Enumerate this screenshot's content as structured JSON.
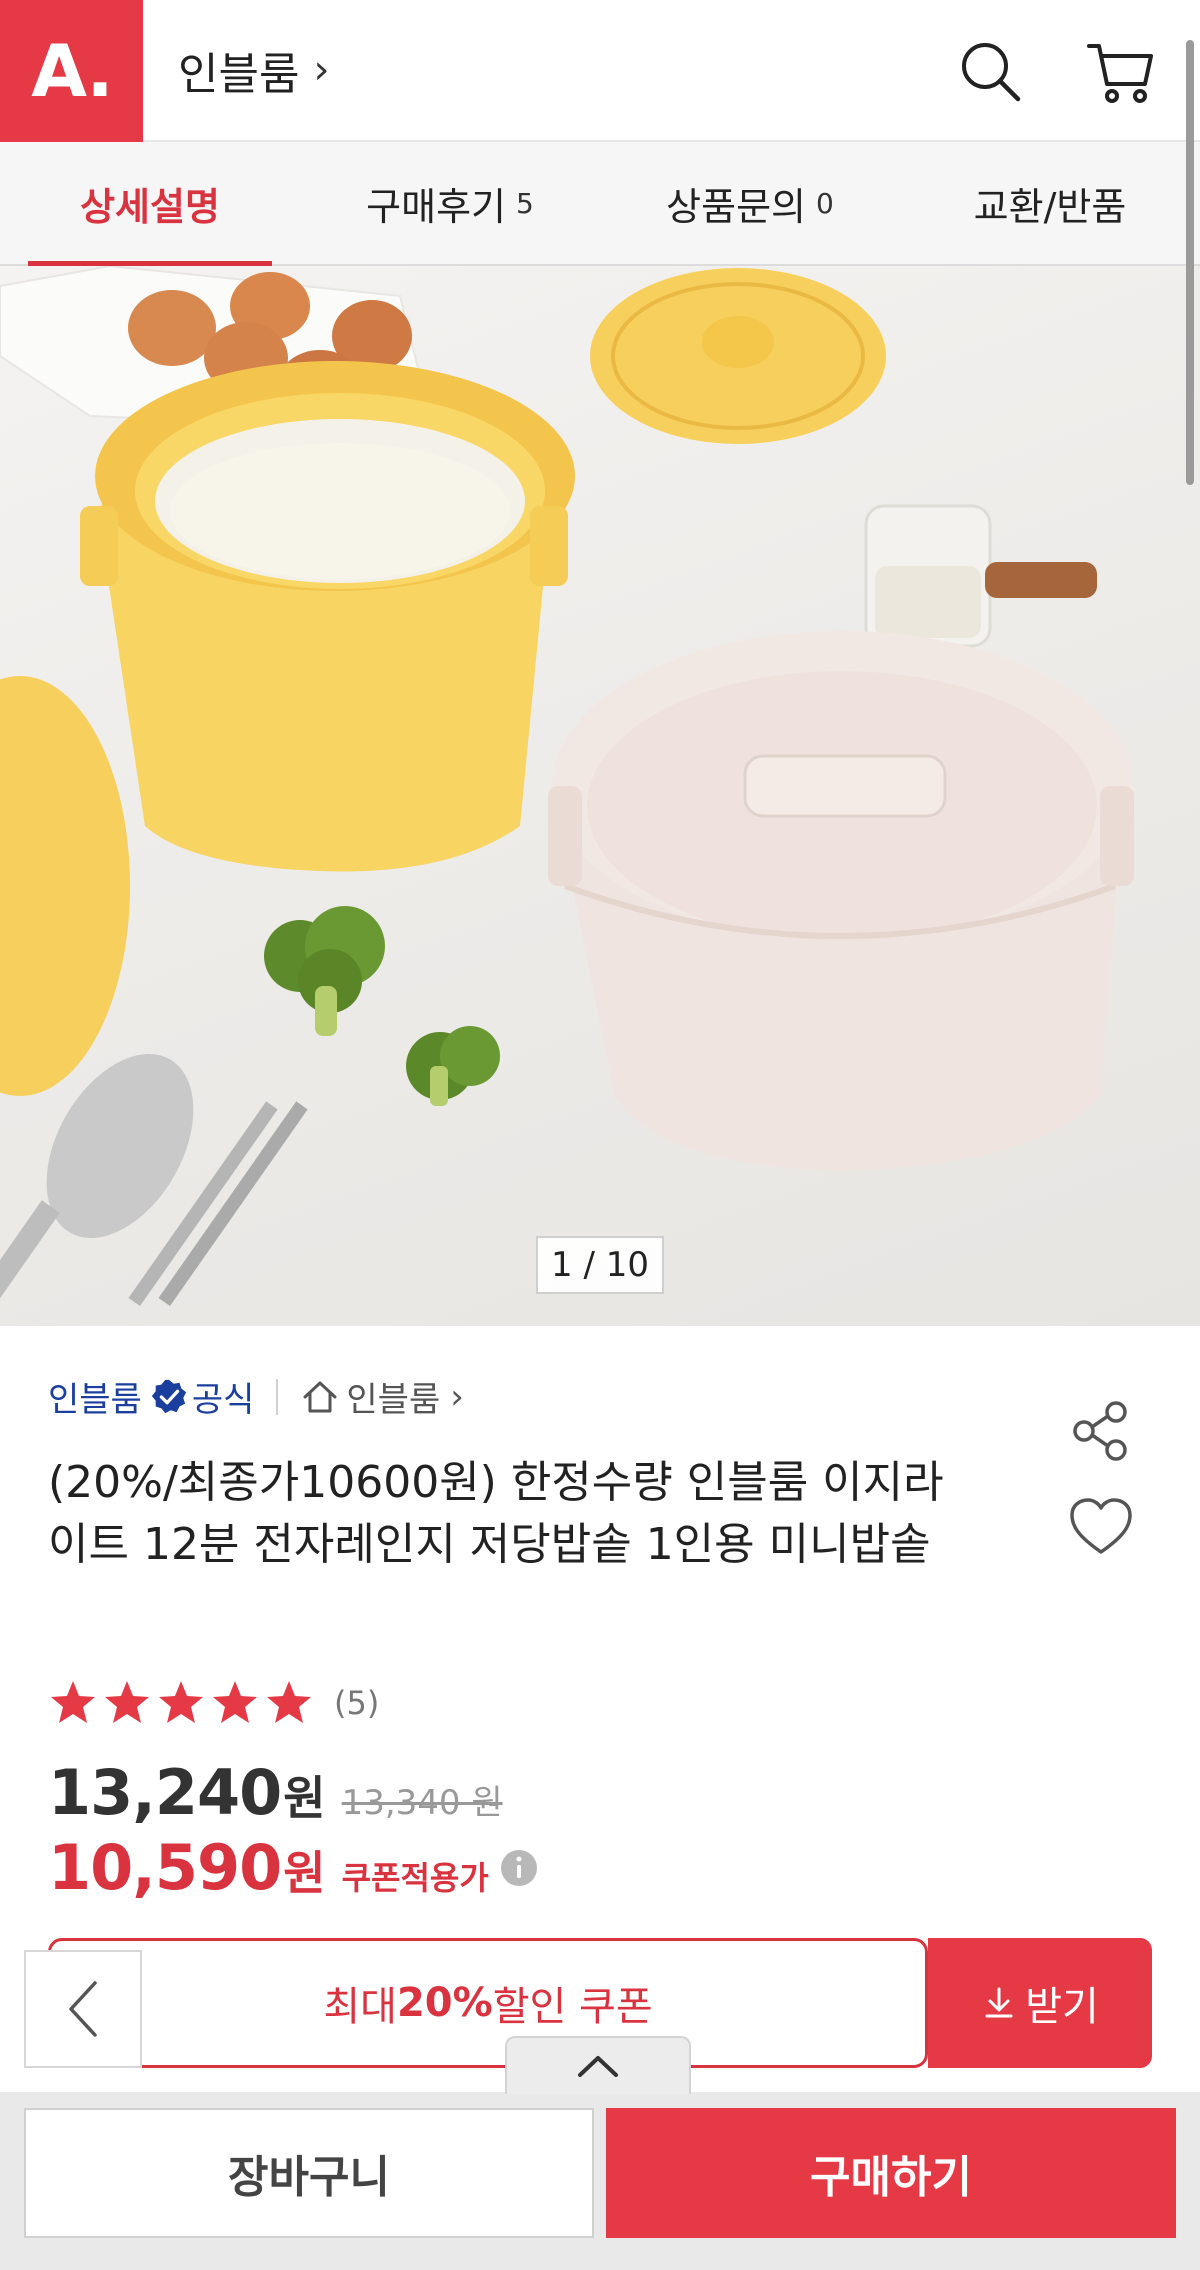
{
  "header": {
    "logo_text": "A.",
    "store_name": "인블룸",
    "store_chevron": "›"
  },
  "tabs": [
    {
      "label": "상세설명",
      "count": ""
    },
    {
      "label": "구매후기",
      "count": "5"
    },
    {
      "label": "상품문의",
      "count": "0"
    },
    {
      "label": "교환/반품",
      "count": ""
    }
  ],
  "gallery": {
    "page_indicator": "1 / 10"
  },
  "product": {
    "brand": "인블룸",
    "official_label": "공식",
    "shop_name": "인블룸",
    "shop_chevron": "›",
    "title": "(20%/최종가10600원) 한정수량 인블룸 이지라이트 12분 전자레인지 저당밥솥 1인용 미니밥솥",
    "review_count": "(5)",
    "rating": 5,
    "price": "13,240",
    "price_unit": "원",
    "original_price": "13,340 원",
    "coupon_price": "10,590",
    "coupon_price_unit": "원",
    "coupon_price_label": "쿠폰적용가"
  },
  "coupon": {
    "prefix": "최대 ",
    "percent": "20%",
    "suffix": " 할인 쿠폰",
    "receive_label": "받기"
  },
  "bottom_bar": {
    "cart_label": "장바구니",
    "buy_label": "구매하기"
  },
  "colors": {
    "brand_red": "#e63946",
    "accent_red": "#d8333f",
    "official_blue": "#1a3f9c"
  }
}
